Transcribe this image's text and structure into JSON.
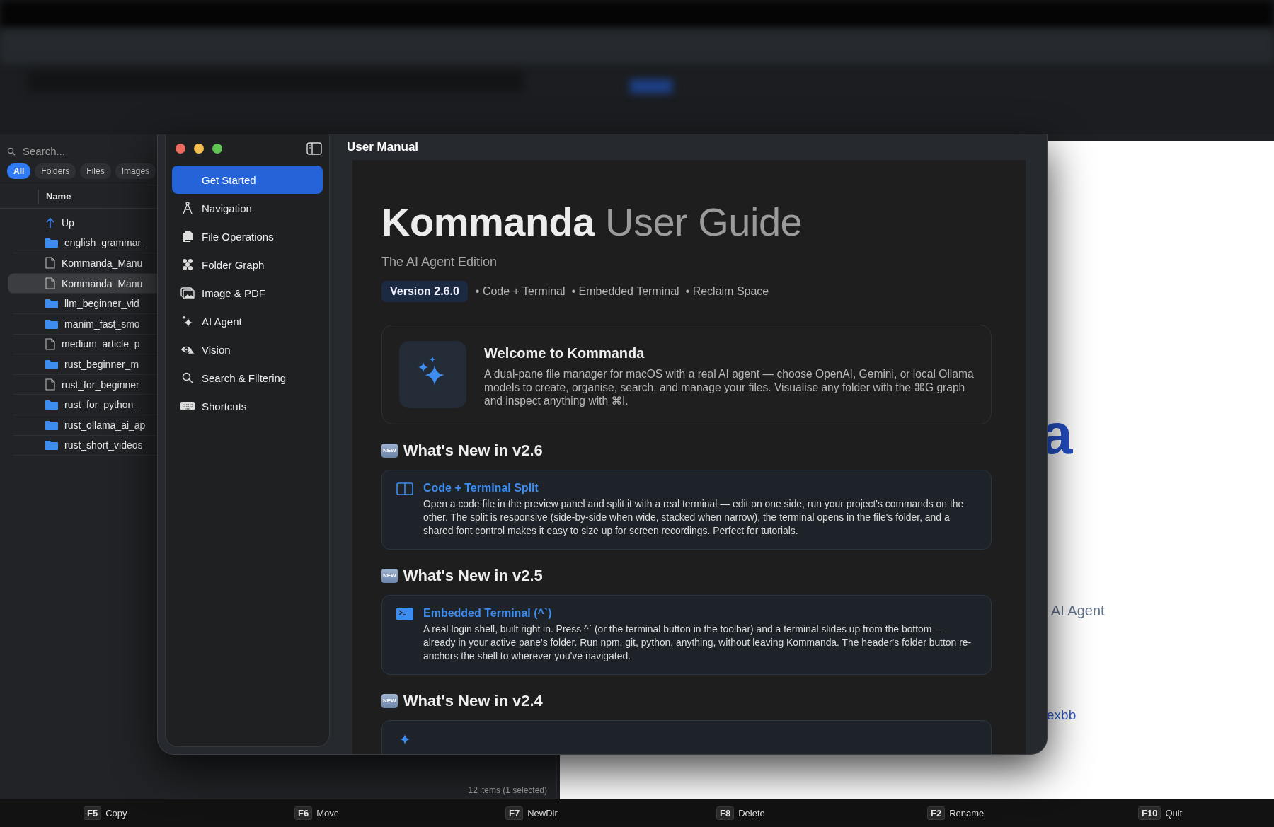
{
  "file_pane": {
    "search": {
      "placeholder": "Search..."
    },
    "filters": [
      {
        "label": "All",
        "selected": true
      },
      {
        "label": "Folders",
        "selected": false
      },
      {
        "label": "Files",
        "selected": false
      },
      {
        "label": "Images",
        "selected": false
      }
    ],
    "columns": [
      "Name"
    ],
    "rows": [
      {
        "kind": "up",
        "name": "Up",
        "selected": false
      },
      {
        "kind": "folder",
        "name": "english_grammar_",
        "selected": false
      },
      {
        "kind": "file",
        "name": "Kommanda_Manu",
        "selected": false
      },
      {
        "kind": "file",
        "name": "Kommanda_Manu",
        "selected": true
      },
      {
        "kind": "folder",
        "name": "llm_beginner_vid",
        "selected": false
      },
      {
        "kind": "folder",
        "name": "manim_fast_smo",
        "selected": false
      },
      {
        "kind": "file",
        "name": "medium_article_p",
        "selected": false
      },
      {
        "kind": "folder",
        "name": "rust_beginner_m",
        "selected": false
      },
      {
        "kind": "file",
        "name": "rust_for_beginner",
        "selected": false
      },
      {
        "kind": "folder",
        "name": "rust_for_python_",
        "selected": false
      },
      {
        "kind": "folder",
        "name": "rust_ollama_ai_ap",
        "selected": false
      },
      {
        "kind": "folder",
        "name": "rust_short_videos",
        "selected": false
      }
    ],
    "status": "12 items (1 selected)"
  },
  "preview": {
    "heading_fragment": "a",
    "line_fragment": "AI Agent",
    "link_fragment": "exbb"
  },
  "manual_window": {
    "title": "User Manual",
    "sidebar": [
      {
        "label": "Get Started",
        "selected": true
      },
      {
        "label": "Navigation",
        "selected": false
      },
      {
        "label": "File Operations",
        "selected": false
      },
      {
        "label": "Folder Graph",
        "selected": false
      },
      {
        "label": "Image & PDF",
        "selected": false
      },
      {
        "label": "AI Agent",
        "selected": false
      },
      {
        "label": "Vision",
        "selected": false
      },
      {
        "label": "Search & Filtering",
        "selected": false
      },
      {
        "label": "Shortcuts",
        "selected": false
      }
    ],
    "heading": {
      "bold": "Kommanda",
      "light": "User Guide"
    },
    "subtitle": "The AI Agent Edition",
    "version": "Version 2.6.0",
    "highlights": [
      "• Code + Terminal",
      "• Embedded Terminal",
      "• Reclaim Space"
    ],
    "welcome": {
      "title": "Welcome to Kommanda",
      "text": "A dual-pane file manager for macOS with a real AI agent — choose OpenAI, Gemini, or local Ollama models to create, organise, search, and manage your files. Visualise any folder with the ⌘G graph and inspect anything with ⌘I."
    },
    "sections": [
      {
        "badge": "NEW",
        "heading": "What's New in v2.6",
        "features": [
          {
            "title": "Code + Terminal Split",
            "text": "Open a code file in the preview panel and split it with a real terminal — edit on one side, run your project's commands on the other. The split is responsive (side-by-side when wide, stacked when narrow), the terminal opens in the file's folder, and a shared font control makes it easy to size up for screen recordings. Perfect for tutorials."
          }
        ]
      },
      {
        "badge": "NEW",
        "heading": "What's New in v2.5",
        "features": [
          {
            "title": "Embedded Terminal (^`)",
            "text": "A real login shell, built right in. Press ^` (or the terminal button in the toolbar) and a terminal slides up from the bottom — already in your active pane's folder. Run npm, git, python, anything, without leaving Kommanda. The header's folder button re-anchors the shell to wherever you've navigated."
          }
        ]
      },
      {
        "badge": "NEW",
        "heading": "What's New in v2.4",
        "features": [
          {
            "kind": "cut_off"
          }
        ]
      }
    ]
  },
  "function_keys": [
    {
      "key": "F5",
      "label": "Copy"
    },
    {
      "key": "F6",
      "label": "Move"
    },
    {
      "key": "F7",
      "label": "NewDir"
    },
    {
      "key": "F8",
      "label": "Delete"
    },
    {
      "key": "F2",
      "label": "Rename"
    },
    {
      "key": "F10",
      "label": "Quit"
    }
  ]
}
